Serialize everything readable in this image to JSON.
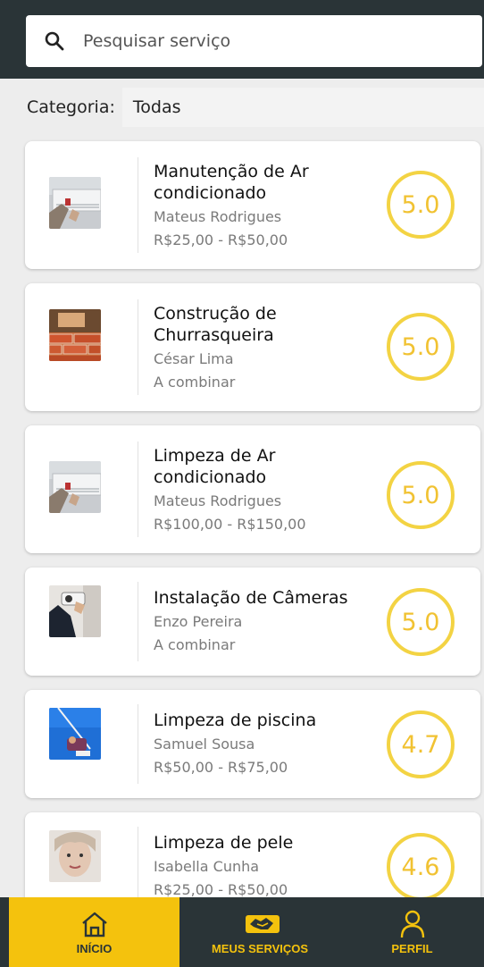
{
  "search": {
    "placeholder": "Pesquisar serviço"
  },
  "category": {
    "label": "Categoria:",
    "value": "Todas"
  },
  "services": [
    {
      "title_lines": [
        "Manutenção de Ar",
        "condicionado"
      ],
      "provider": "Mateus Rodrigues",
      "price": "R$25,00 - R$50,00",
      "rating": "5.0",
      "image": "air-conditioner-photo"
    },
    {
      "title_lines": [
        "Construção de",
        "Churrasqueira"
      ],
      "provider": "César Lima",
      "price": "A combinar",
      "rating": "5.0",
      "image": "bricklaying-photo"
    },
    {
      "title_lines": [
        "Limpeza de Ar",
        "condicionado"
      ],
      "provider": "Mateus Rodrigues",
      "price": "R$100,00 - R$150,00",
      "rating": "5.0",
      "image": "air-conditioner-photo"
    },
    {
      "title_lines": [
        "Instalação de Câmeras"
      ],
      "provider": "Enzo Pereira",
      "price": "A combinar",
      "rating": "5.0",
      "image": "security-camera-photo"
    },
    {
      "title_lines": [
        "Limpeza de piscina"
      ],
      "provider": "Samuel Sousa",
      "price": "R$50,00 - R$75,00",
      "rating": "4.7",
      "image": "pool-cleaning-photo"
    },
    {
      "title_lines": [
        "Limpeza de pele"
      ],
      "provider": "Isabella Cunha",
      "price": "R$25,00 - R$50,00",
      "rating": "4.6",
      "image": "skin-care-photo"
    }
  ],
  "nav": {
    "items": [
      {
        "label": "INÍCIO",
        "icon": "home-icon",
        "active": true
      },
      {
        "label": "MEUS SERVIÇOS",
        "icon": "handshake-icon",
        "active": false
      },
      {
        "label": "PERFIL",
        "icon": "user-icon",
        "active": false
      }
    ]
  },
  "colors": {
    "bar": "#2a3437",
    "accent": "#f4c20d",
    "rating": "#f1c232"
  }
}
